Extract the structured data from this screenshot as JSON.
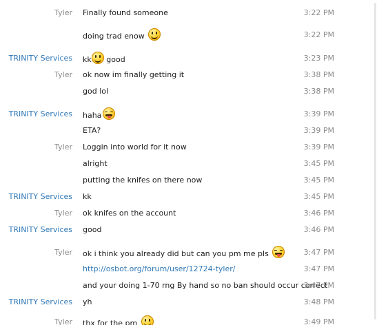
{
  "messages": [
    {
      "sender": "Tyler",
      "text": "Finally found someone",
      "time": "3:22 PM"
    },
    {
      "sender": "",
      "text": "doing trad enow",
      "emoji": "smile",
      "time": "3:22 PM"
    },
    {
      "sender": "TRINITY Services",
      "text": "kk",
      "emoji_mid": "smile",
      "text2": "good",
      "time": "3:23 PM"
    },
    {
      "sender": "Tyler",
      "text": "ok now im finally getting it",
      "time": "3:38 PM"
    },
    {
      "sender": "",
      "text": "god lol",
      "time": "3:38 PM"
    },
    {
      "sender": "TRINITY Services",
      "text": "haha",
      "emoji": "tongue",
      "time": "3:39 PM"
    },
    {
      "sender": "",
      "text": "ETA?",
      "time": "3:39 PM"
    },
    {
      "sender": "Tyler",
      "text": "Loggin into world for it now",
      "time": "3:39 PM"
    },
    {
      "sender": "",
      "text": "alright",
      "time": "3:45 PM"
    },
    {
      "sender": "",
      "text": "putting the knifes on there now",
      "time": "3:45 PM"
    },
    {
      "sender": "TRINITY Services",
      "text": "kk",
      "time": "3:45 PM"
    },
    {
      "sender": "Tyler",
      "text": "ok knifes on the account",
      "time": "3:46 PM"
    },
    {
      "sender": "TRINITY Services",
      "text": "good",
      "time": "3:46 PM"
    },
    {
      "sender": "Tyler",
      "text": "ok i think you already did but can you pm me pls",
      "emoji": "tongue",
      "time": "3:47 PM"
    },
    {
      "sender": "",
      "text": "http://osbot.org/forum/user/12724-tyler/",
      "link": true,
      "time": "3:47 PM"
    },
    {
      "sender": "",
      "text": "and your doing 1-70 rng By hand so no ban should occur correct",
      "time": "3:47 PM"
    },
    {
      "sender": "TRINITY Services",
      "text": "yh",
      "time": "3:48 PM"
    },
    {
      "sender": "Tyler",
      "text": "thx for the pm",
      "emoji": "smile",
      "time": "3:49 PM"
    }
  ],
  "colors": {
    "trinity": "#2f78b7",
    "tyler": "#8a8a8a",
    "link": "#2f78b7"
  }
}
